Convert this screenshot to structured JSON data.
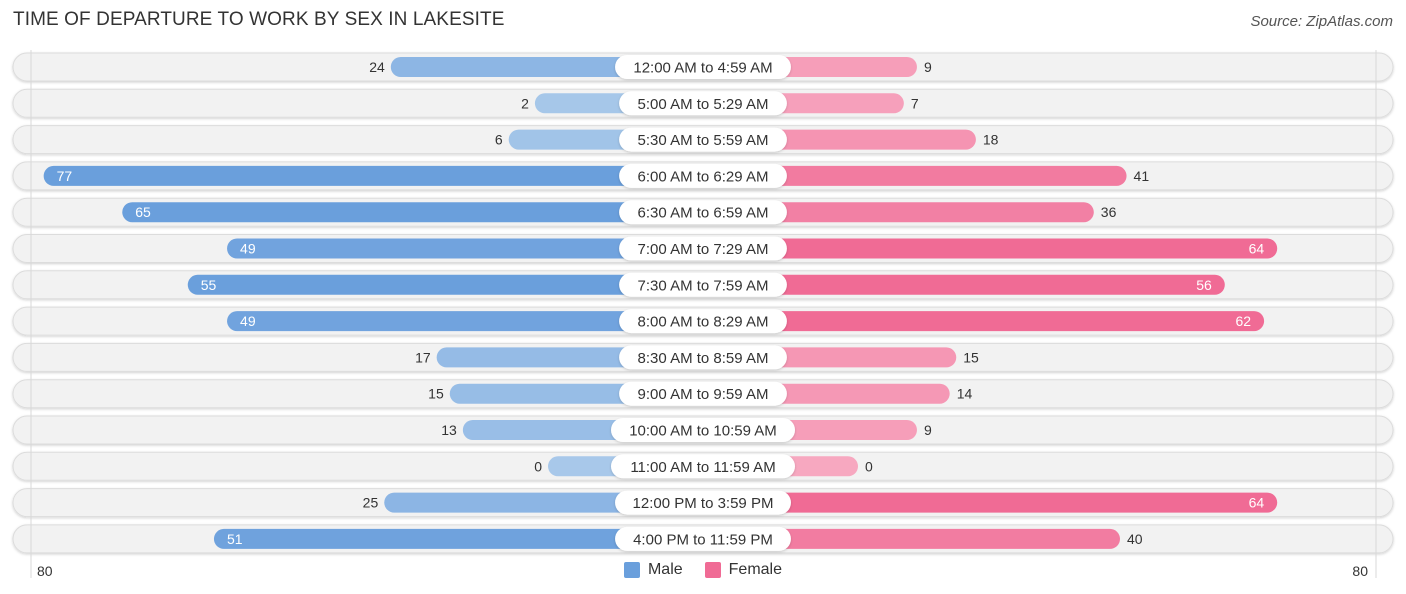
{
  "header": {
    "title": "TIME OF DEPARTURE TO WORK BY SEX IN LAKESITE",
    "source": "Source: ZipAtlas.com"
  },
  "colors": {
    "male_dark": "#6a9fdc",
    "male_light": "#a8c8ea",
    "female_dark": "#f06b95",
    "female_light": "#f7a8c0",
    "row_bg": "#f2f2f2"
  },
  "chart_data": {
    "type": "bar",
    "orientation": "horizontal-diverging",
    "title": "TIME OF DEPARTURE TO WORK BY SEX IN LAKESITE",
    "categories": [
      "12:00 AM to 4:59 AM",
      "5:00 AM to 5:29 AM",
      "5:30 AM to 5:59 AM",
      "6:00 AM to 6:29 AM",
      "6:30 AM to 6:59 AM",
      "7:00 AM to 7:29 AM",
      "7:30 AM to 7:59 AM",
      "8:00 AM to 8:29 AM",
      "8:30 AM to 8:59 AM",
      "9:00 AM to 9:59 AM",
      "10:00 AM to 10:59 AM",
      "11:00 AM to 11:59 AM",
      "12:00 PM to 3:59 PM",
      "4:00 PM to 11:59 PM"
    ],
    "series": [
      {
        "name": "Male",
        "values": [
          24,
          2,
          6,
          77,
          65,
          49,
          55,
          49,
          17,
          15,
          13,
          0,
          25,
          51
        ]
      },
      {
        "name": "Female",
        "values": [
          9,
          7,
          18,
          41,
          36,
          64,
          56,
          62,
          15,
          14,
          9,
          0,
          64,
          40
        ]
      }
    ],
    "axis": {
      "left_label": "80",
      "right_label": "80",
      "max": 80
    },
    "legend": {
      "position": "bottom-center",
      "entries": [
        "Male",
        "Female"
      ]
    }
  }
}
